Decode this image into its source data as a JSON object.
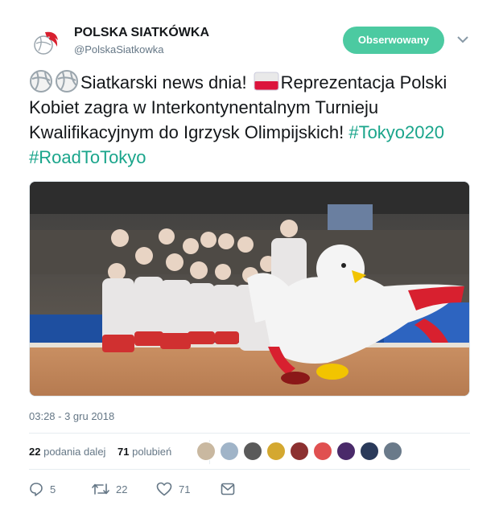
{
  "account": {
    "name": "POLSKA SIATKÓWKA",
    "handle": "@PolskaSiatkowka",
    "follow_label": "Obserwowany"
  },
  "tweet": {
    "text_part1": "Siatkarski news dnia!",
    "text_part2": "Reprezentacja Polski Kobiet zagra w Interkontynentalnym Turnieju Kwalifikacyjnym do Igrzysk Olimpijskich!",
    "hashtag1": "#Tokyo2020",
    "hashtag2": "#RoadToTokyo",
    "timestamp": "03:28 - 3 gru 2018"
  },
  "stats": {
    "retweets_count": "22",
    "retweets_label": "podania dalej",
    "likes_count": "71",
    "likes_label": "polubień"
  },
  "actions": {
    "reply_count": "5",
    "retweet_count": "22",
    "like_count": "71"
  },
  "colors": {
    "accent": "#1aa58b",
    "follow_button": "#4ccaa1",
    "secondary_text": "#657786"
  }
}
